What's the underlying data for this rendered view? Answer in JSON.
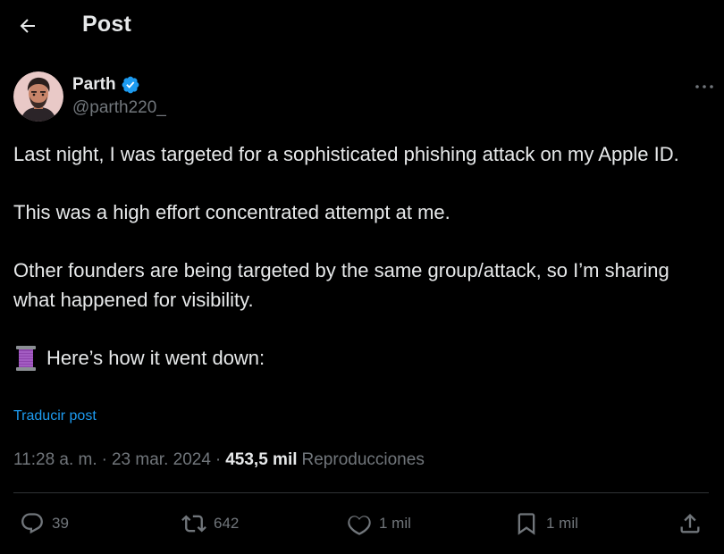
{
  "header": {
    "title": "Post"
  },
  "author": {
    "name": "Parth",
    "handle": "@parth220_"
  },
  "tweet": {
    "paragraphs": [
      "Last night, I was targeted for a sophisticated phishing attack on my Apple ID.",
      "This was a high effort concentrated attempt at me.",
      "Other founders are being targeted by the same group/attack, so I’m sharing what happened for visibility."
    ],
    "thread_intro": "Here’s how it went down:",
    "translate_label": "Traducir post"
  },
  "meta": {
    "time": "11:28 a. m.",
    "separator": "·",
    "date": "23 mar. 2024",
    "views_count": "453,5 mil",
    "views_label": "Reproducciones"
  },
  "actions": {
    "replies": "39",
    "reposts": "642",
    "likes": "1 mil",
    "bookmarks": "1 mil"
  },
  "colors": {
    "background": "#000000",
    "text": "#e7e9ea",
    "secondary": "#71767b",
    "accent": "#1d9bf0",
    "divider": "#2f3336"
  },
  "icons": {
    "back": "arrow-left-icon",
    "verified": "verified-badge-icon",
    "more": "more-horizontal-icon",
    "thread": "spool-of-thread-emoji",
    "reply": "reply-bubble-icon",
    "repost": "repost-icon",
    "like": "heart-icon",
    "bookmark": "bookmark-icon",
    "share": "share-icon"
  }
}
